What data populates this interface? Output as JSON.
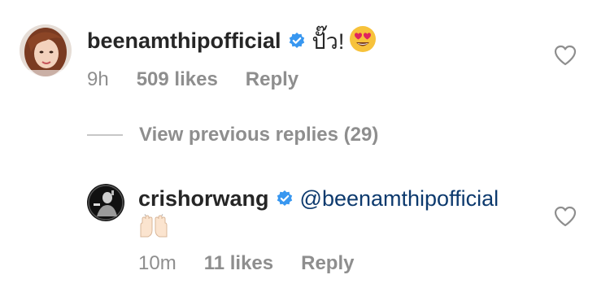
{
  "comment": {
    "username": "beenamthipofficial",
    "text": "ปั๊ว!",
    "emoji": "heart-eyes-emoji",
    "time": "9h",
    "likes": "509 likes",
    "reply_label": "Reply"
  },
  "view_previous": {
    "label": "View previous replies (29)"
  },
  "reply": {
    "username": "crishorwang",
    "mention": "@beenamthipofficial",
    "emoji": "raised-hands-emoji",
    "time": "10m",
    "likes": "11 likes",
    "reply_label": "Reply"
  },
  "colors": {
    "verified": "#3897f0",
    "mention": "#0d3a6e",
    "meta": "#8e8e8e"
  }
}
